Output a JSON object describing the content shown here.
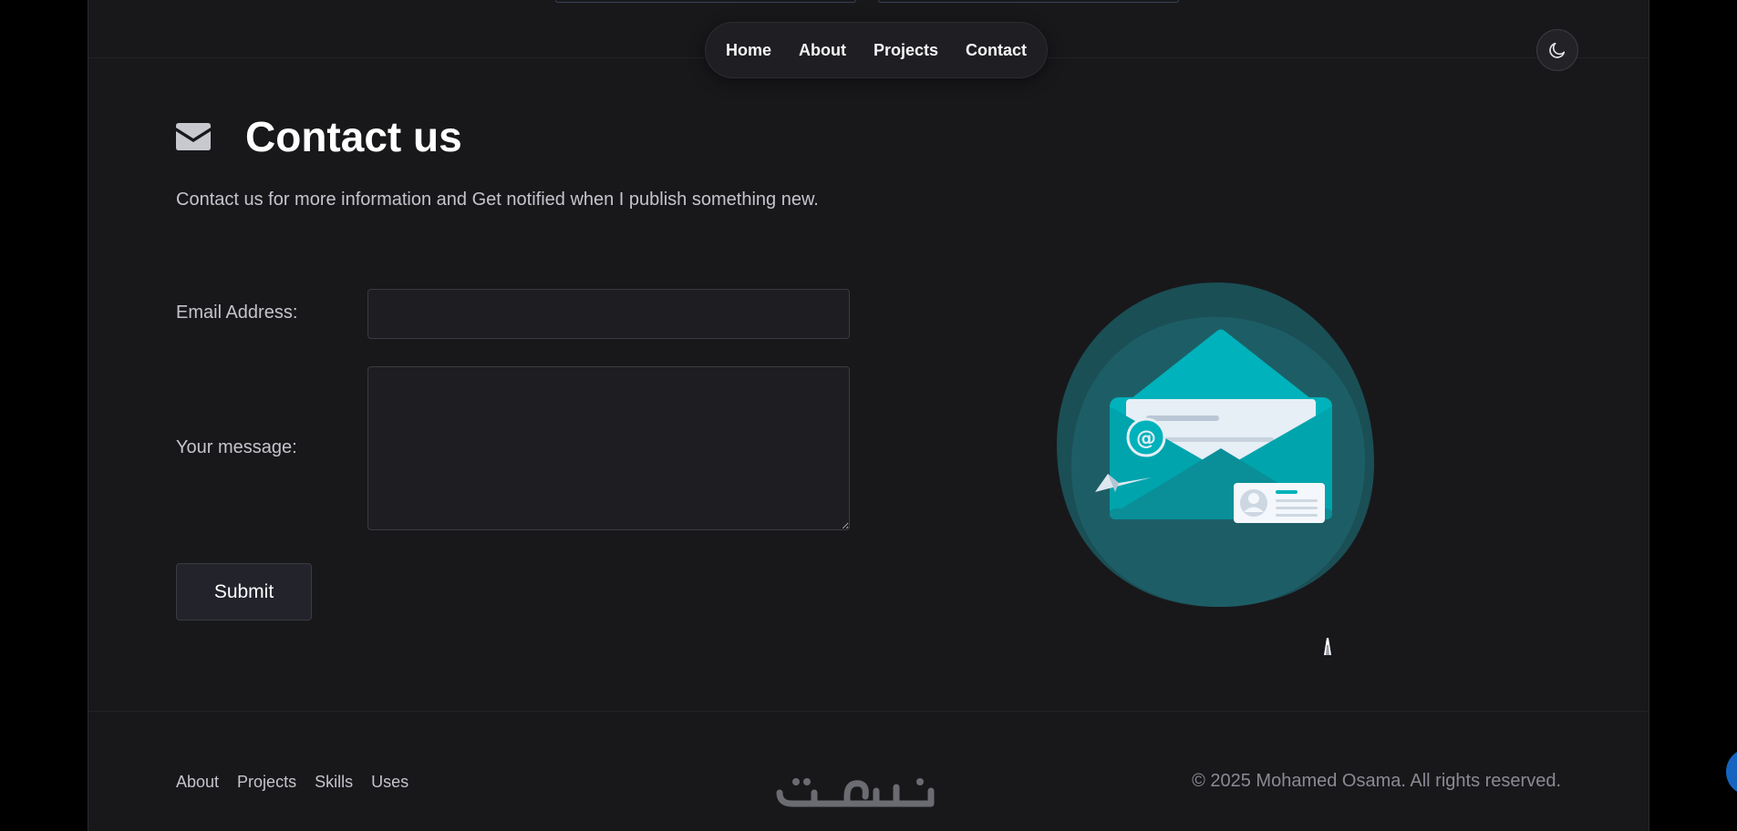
{
  "nav": {
    "items": [
      {
        "label": "Home"
      },
      {
        "label": "About"
      },
      {
        "label": "Projects"
      },
      {
        "label": "Contact"
      }
    ],
    "theme_toggle_icon": "moon-icon"
  },
  "contact": {
    "title": "Contact us",
    "title_icon": "envelope-icon",
    "subtitle": "Contact us for more information and Get notified when I publish something new.",
    "email_label": "Email Address:",
    "email_value": "",
    "message_label": "Your message:",
    "message_value": "",
    "submit_label": "Submit"
  },
  "illustration": {
    "name": "mail-envelope-illustration",
    "accent": "#00b2bb",
    "blob_outer": "#1a4f55",
    "blob_inner": "#1d5e66"
  },
  "footer": {
    "links": [
      {
        "label": "About"
      },
      {
        "label": "Projects"
      },
      {
        "label": "Skills"
      },
      {
        "label": "Uses"
      }
    ],
    "logo_text": "خمسات",
    "copyright": "© 2025 Mohamed Osama. All rights reserved.",
    "scroll_top_icon": "chevron-up-icon"
  },
  "colors": {
    "background": "#18181b",
    "outer": "#000000",
    "scroll_button": "#1565c0"
  }
}
